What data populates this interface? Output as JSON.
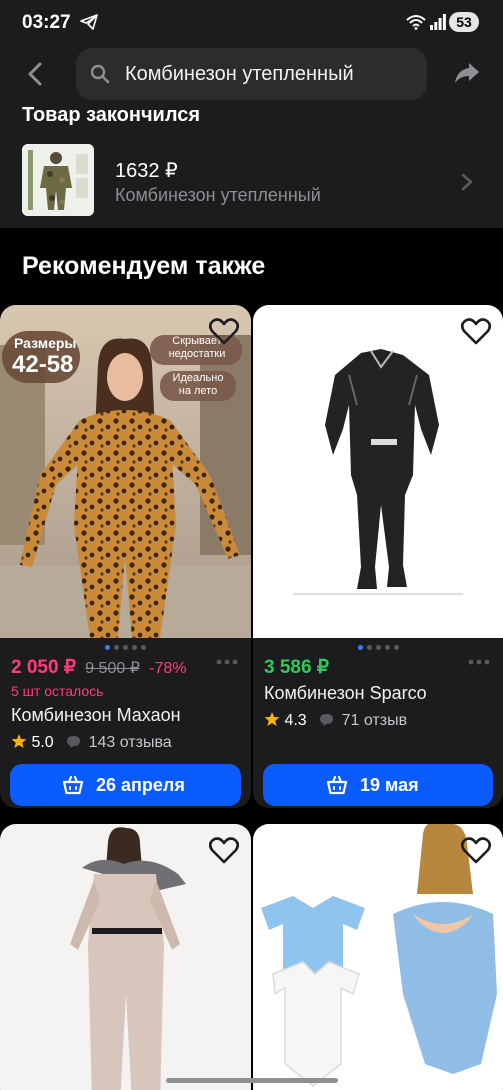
{
  "status": {
    "time": "03:27",
    "battery": "53"
  },
  "search": {
    "query": "Комбинезон утепленный"
  },
  "order": {
    "status_text": "Товар закончился",
    "price": "1632 ₽",
    "name": "Комбинезон утепленный"
  },
  "recommendations": {
    "title": "Рекомендуем также",
    "cards": [
      {
        "price": "2 050 ₽",
        "old_price": "9 500 ₽",
        "discount": "-78%",
        "stock": "5 шт осталось",
        "name": "Комбинезон Махаон",
        "rating": "5.0",
        "reviews": "143 отзыва",
        "delivery": "26 апреля",
        "badge_sizes_label": "Размеры",
        "badge_sizes_value": "42-58",
        "badge_hide": "Скрывает недостатки",
        "badge_summer": "Идеально на лето",
        "price_color": "#ff3b7d"
      },
      {
        "price": "3 586 ₽",
        "name": "Комбинезон Sparco",
        "rating": "4.3",
        "reviews": "71 отзыв",
        "delivery": "19 мая",
        "price_color": "#34c759"
      }
    ]
  },
  "colors": {
    "accent": "#0a5cff",
    "sale": "#ff3b7d",
    "success": "#34c759",
    "star": "#ffb400"
  }
}
